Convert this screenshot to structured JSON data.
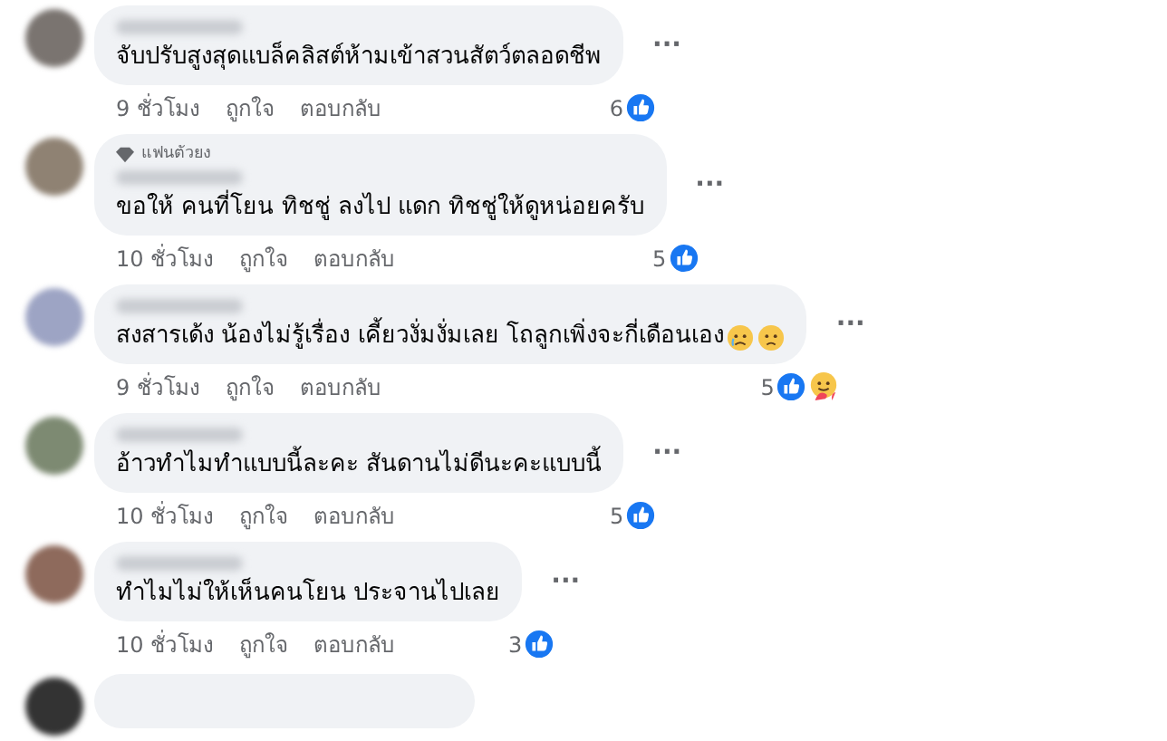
{
  "comments": [
    {
      "text": "จับปรับสูงสุดแบล็คลิสต์ห้ามเข้าสวนสัตว์ตลอดชีพ",
      "time": "9 ชั่วโมง",
      "like_action": "ถูกใจ",
      "reply_action": "ตอบกลับ",
      "reaction_count": "6",
      "reactions": [
        {
          "kind": "like"
        }
      ],
      "menu": "···"
    },
    {
      "badge": "แฟนตัวยง",
      "text": "ขอให้ คนที่โยน ทิชชู่ ลงไป แดก ทิชชู่ให้ดูหน่อยครับ",
      "time": "10 ชั่วโมง",
      "like_action": "ถูกใจ",
      "reply_action": "ตอบกลับ",
      "reaction_count": "5",
      "reactions": [
        {
          "kind": "like"
        }
      ],
      "menu": "···"
    },
    {
      "text": "สงสารเด้ง น้องไม่รู้เรื่อง เคี้ยวงั่มงั่มเลย โถลูกเพิ่งจะกี่เดือนเอง",
      "emojis": [
        {
          "kind": "cry"
        },
        {
          "kind": "sad"
        }
      ],
      "time": "9 ชั่วโมง",
      "like_action": "ถูกใจ",
      "reply_action": "ตอบกลับ",
      "reaction_count": "5",
      "reactions": [
        {
          "kind": "like"
        },
        {
          "kind": "care"
        }
      ],
      "menu": "···"
    },
    {
      "text": "อ้าวทำไมทำแบบนี้ละคะ สันดานไม่ดีนะคะแบบนี้",
      "time": "10 ชั่วโมง",
      "like_action": "ถูกใจ",
      "reply_action": "ตอบกลับ",
      "reaction_count": "5",
      "reactions": [
        {
          "kind": "like"
        }
      ],
      "menu": "···"
    },
    {
      "text": "ทำไมไม่ให้เห็นคนโยน ประจานไปเลย",
      "time": "10 ชั่วโมง",
      "like_action": "ถูกใจ",
      "reply_action": "ตอบกลับ",
      "reaction_count": "3",
      "reactions": [
        {
          "kind": "like"
        }
      ],
      "menu": "···"
    }
  ]
}
